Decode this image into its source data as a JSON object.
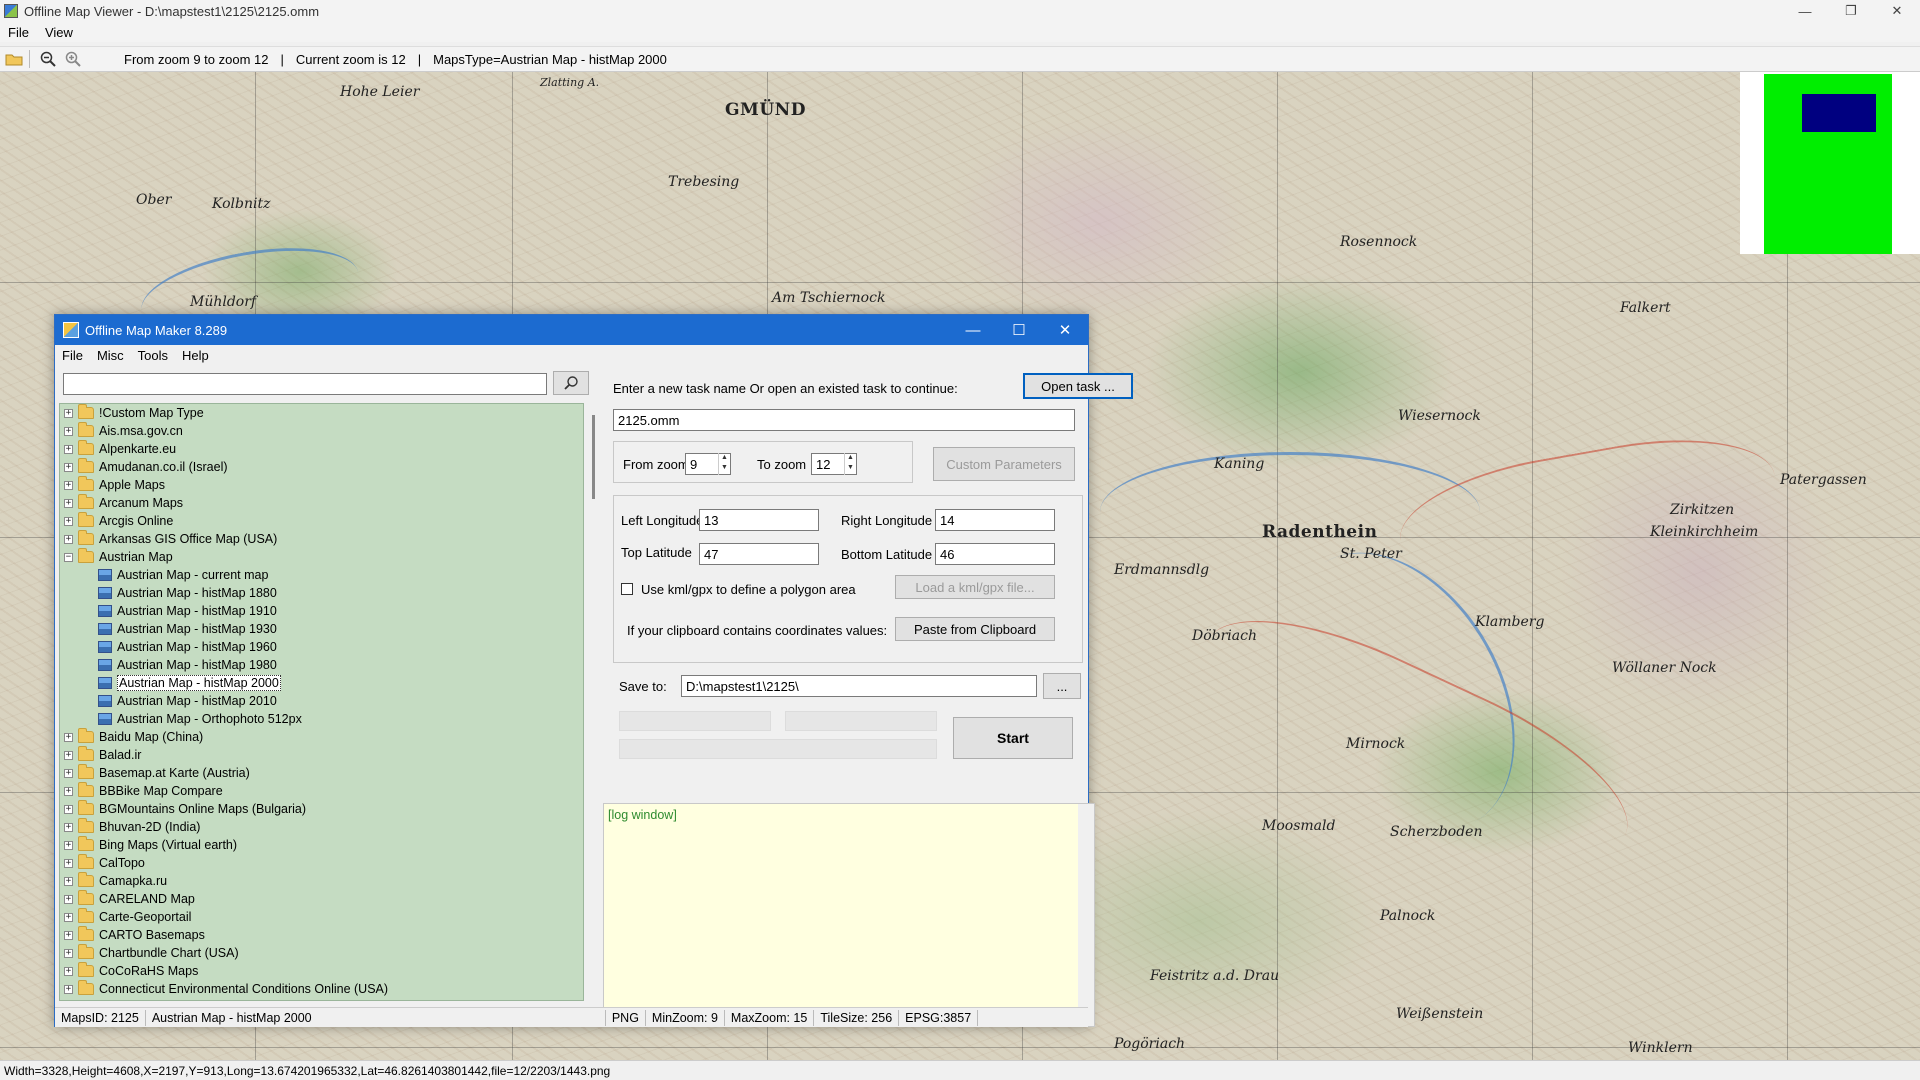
{
  "window": {
    "title": "Offline Map Viewer - D:\\mapstest1\\2125\\2125.omm",
    "controls": [
      "—",
      "❐",
      "✕"
    ]
  },
  "menu": [
    "File",
    "View"
  ],
  "toolbar": {
    "zoom_range": "From zoom 9 to zoom 12",
    "current_zoom": "Current zoom is 12",
    "maps_type": "MapsType=Austrian Map - histMap 2000"
  },
  "map": {
    "labels": [
      {
        "text": "GMÜND",
        "kind": "big"
      },
      {
        "text": "Radenthein",
        "kind": "big"
      },
      {
        "text": "Zlatting A.",
        "kind": "small"
      },
      {
        "text": "Hohe Leier",
        "kind": "normal"
      },
      {
        "text": "Trebesing",
        "kind": "normal"
      },
      {
        "text": "Rosennock",
        "kind": "normal"
      },
      {
        "text": "Mühldorf",
        "kind": "normal"
      },
      {
        "text": "Am Tschiernock",
        "kind": "normal"
      },
      {
        "text": "Wiesernock",
        "kind": "normal"
      },
      {
        "text": "Ober",
        "kind": "normal"
      },
      {
        "text": "Kolbnitz",
        "kind": "normal"
      },
      {
        "text": "St. Peter",
        "kind": "normal"
      },
      {
        "text": "Erdmannsdlg",
        "kind": "normal"
      },
      {
        "text": "Döbriach",
        "kind": "normal"
      },
      {
        "text": "Mirnock",
        "kind": "normal"
      },
      {
        "text": "Klamberg",
        "kind": "normal"
      },
      {
        "text": "Wöllaner Nock",
        "kind": "normal"
      },
      {
        "text": "Moosmald",
        "kind": "normal"
      },
      {
        "text": "Scherzboden",
        "kind": "normal"
      },
      {
        "text": "Palnock",
        "kind": "normal"
      },
      {
        "text": "Feistritz a.d. Drau",
        "kind": "normal"
      },
      {
        "text": "Weißenstein",
        "kind": "normal"
      },
      {
        "text": "Pogöriach",
        "kind": "normal"
      },
      {
        "text": "Winklern",
        "kind": "normal"
      },
      {
        "text": "Kaning",
        "kind": "normal"
      },
      {
        "text": "Falkert",
        "kind": "normal"
      },
      {
        "text": "Zirkitzen",
        "kind": "normal"
      },
      {
        "text": "Kleinkirchheim",
        "kind": "normal"
      },
      {
        "text": "Patergassen",
        "kind": "normal"
      }
    ]
  },
  "statusbar": "Width=3328,Height=4608,X=2197,Y=913,Long=13.674201965332,Lat=46.8261403801442,file=12/2203/1443.png",
  "dialog": {
    "title": "Offline Map Maker 8.289",
    "controls": [
      "—",
      "☐",
      "✕"
    ],
    "menu": [
      "File",
      "Misc",
      "Tools",
      "Help"
    ],
    "search": {
      "value": "",
      "placeholder": ""
    },
    "tree": [
      {
        "label": "!Custom Map Type",
        "type": "folder",
        "expand": "+"
      },
      {
        "label": "Ais.msa.gov.cn",
        "type": "folder",
        "expand": "+"
      },
      {
        "label": "Alpenkarte.eu",
        "type": "folder",
        "expand": "+"
      },
      {
        "label": "Amudanan.co.il (Israel)",
        "type": "folder",
        "expand": "+"
      },
      {
        "label": "Apple Maps",
        "type": "folder",
        "expand": "+"
      },
      {
        "label": "Arcanum Maps",
        "type": "folder",
        "expand": "+"
      },
      {
        "label": "Arcgis Online",
        "type": "folder",
        "expand": "+"
      },
      {
        "label": "Arkansas GIS Office Map (USA)",
        "type": "folder",
        "expand": "+"
      },
      {
        "label": "Austrian Map",
        "type": "folder-open",
        "expand": "−"
      },
      {
        "label": "Austrian Map - current map",
        "type": "map"
      },
      {
        "label": "Austrian Map - histMap 1880",
        "type": "map"
      },
      {
        "label": "Austrian Map - histMap 1910",
        "type": "map"
      },
      {
        "label": "Austrian Map - histMap 1930",
        "type": "map"
      },
      {
        "label": "Austrian Map - histMap 1960",
        "type": "map"
      },
      {
        "label": "Austrian Map - histMap 1980",
        "type": "map"
      },
      {
        "label": "Austrian Map - histMap 2000",
        "type": "map",
        "selected": true
      },
      {
        "label": "Austrian Map - histMap 2010",
        "type": "map"
      },
      {
        "label": "Austrian Map - Orthophoto 512px",
        "type": "map"
      },
      {
        "label": "Baidu Map (China)",
        "type": "folder",
        "expand": "+"
      },
      {
        "label": "Balad.ir",
        "type": "folder",
        "expand": "+"
      },
      {
        "label": "Basemap.at Karte (Austria)",
        "type": "folder",
        "expand": "+"
      },
      {
        "label": "BBBike Map Compare",
        "type": "folder",
        "expand": "+"
      },
      {
        "label": "BGMountains Online Maps (Bulgaria)",
        "type": "folder",
        "expand": "+"
      },
      {
        "label": "Bhuvan-2D (India)",
        "type": "folder",
        "expand": "+"
      },
      {
        "label": "Bing Maps (Virtual earth)",
        "type": "folder",
        "expand": "+"
      },
      {
        "label": "CalTopo",
        "type": "folder",
        "expand": "+"
      },
      {
        "label": "Camapka.ru",
        "type": "folder",
        "expand": "+"
      },
      {
        "label": "CARELAND Map",
        "type": "folder",
        "expand": "+"
      },
      {
        "label": "Carte-Geoportail",
        "type": "folder",
        "expand": "+"
      },
      {
        "label": "CARTO Basemaps",
        "type": "folder",
        "expand": "+"
      },
      {
        "label": "Chartbundle Chart (USA)",
        "type": "folder",
        "expand": "+"
      },
      {
        "label": "CoCoRaHS Maps",
        "type": "folder",
        "expand": "+"
      },
      {
        "label": "Connecticut Environmental Conditions Online (USA)",
        "type": "folder",
        "expand": "+"
      }
    ],
    "task_prompt": "Enter a new task name Or open an existed task to continue:",
    "open_task_label": "Open task ...",
    "task_name": "2125.omm",
    "from_zoom_label": "From zoom",
    "from_zoom": "9",
    "to_zoom_label": "To zoom",
    "to_zoom": "12",
    "custom_params_label": "Custom Parameters",
    "left_lon_label": "Left Longitude",
    "left_lon": "13",
    "right_lon_label": "Right Longitude",
    "right_lon": "14",
    "top_lat_label": "Top Latitude",
    "top_lat": "47",
    "bottom_lat_label": "Bottom Latitude",
    "bottom_lat": "46",
    "kml_check_label": "Use kml/gpx to define a polygon area",
    "kml_checked": false,
    "load_kml_label": "Load a kml/gpx file...",
    "clipboard_label": "If your clipboard contains coordinates values:",
    "paste_label": "Paste from Clipboard",
    "save_to_label": "Save to:",
    "save_to": "D:\\mapstest1\\2125\\",
    "browse_label": "...",
    "start_label": "Start",
    "log_text": "[log window]",
    "status": {
      "maps_id": "MapsID: 2125",
      "map_name": "Austrian Map - histMap 2000",
      "format": "PNG",
      "min_zoom": "MinZoom: 9",
      "max_zoom": "MaxZoom: 15",
      "tile_size": "TileSize: 256",
      "epsg": "EPSG:3857"
    }
  }
}
